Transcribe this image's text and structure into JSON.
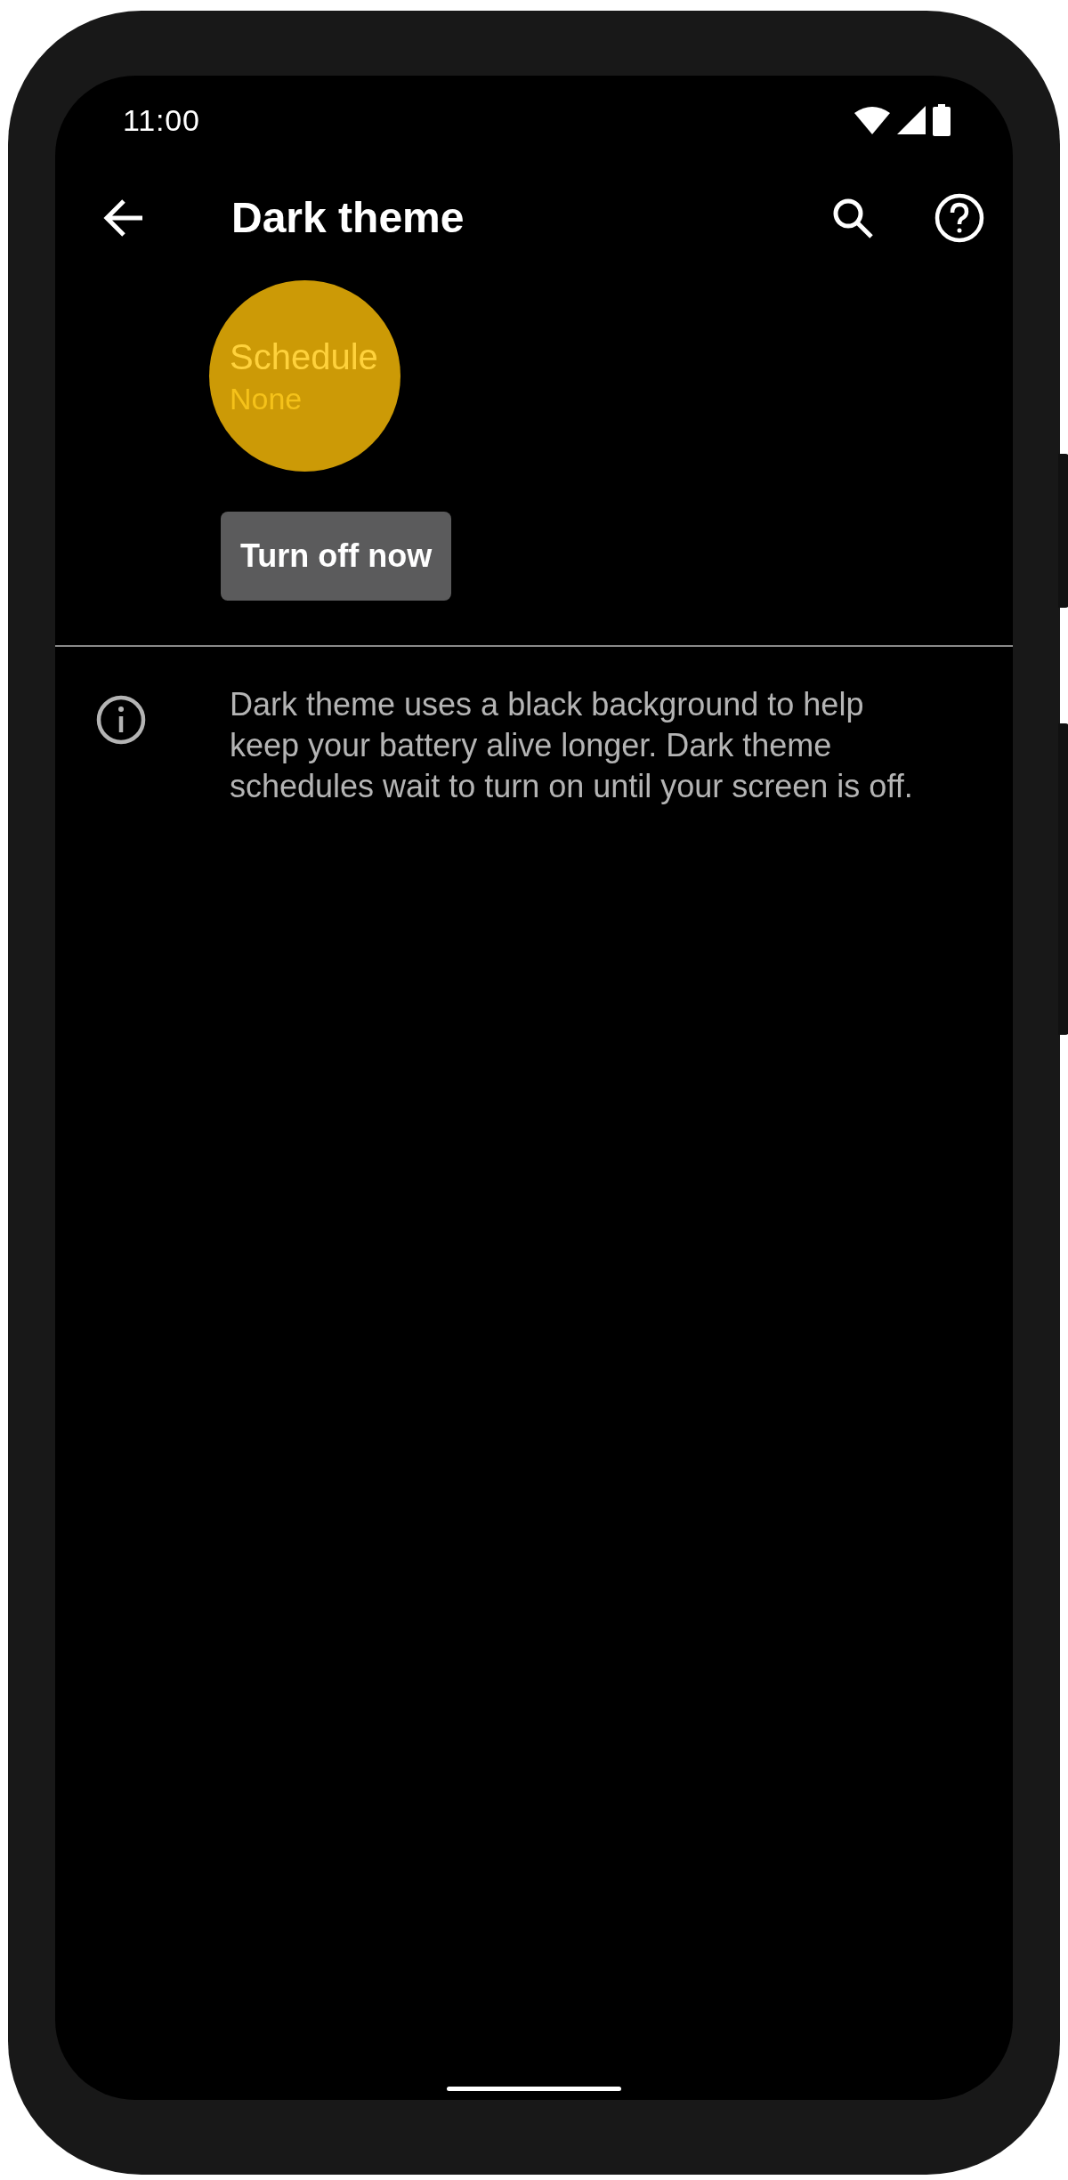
{
  "status_bar": {
    "time": "11:00"
  },
  "toolbar": {
    "title": "Dark theme"
  },
  "schedule": {
    "label": "Schedule",
    "value": "None"
  },
  "action_button": {
    "label": "Turn off now"
  },
  "info": {
    "text": "Dark theme uses a black background to help keep your battery alive longer. Dark theme schedules wait to turn on until your screen is off."
  }
}
